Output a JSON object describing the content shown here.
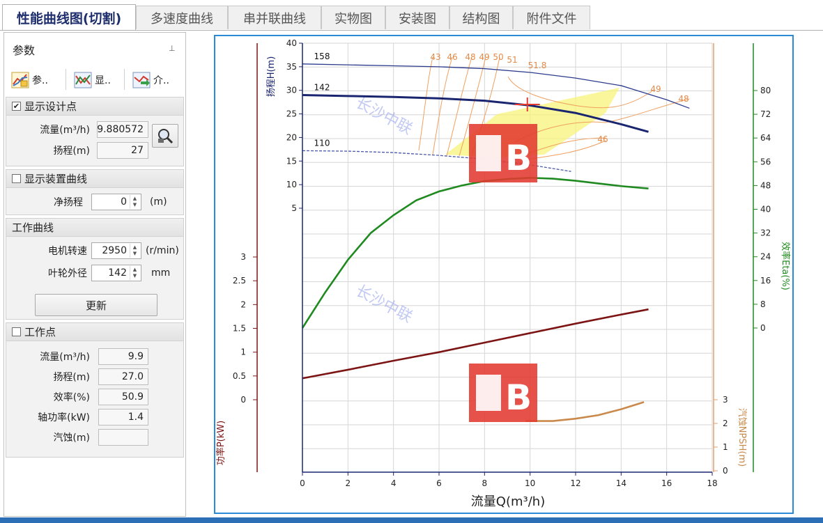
{
  "tabs": [
    {
      "label": "性能曲线图(切割)",
      "active": true
    },
    {
      "label": "多速度曲线"
    },
    {
      "label": "串并联曲线"
    },
    {
      "label": "实物图"
    },
    {
      "label": "安装图"
    },
    {
      "label": "结构图"
    },
    {
      "label": "附件文件"
    }
  ],
  "panel": {
    "title": "参数",
    "pin_icon": "pin-icon",
    "tools": [
      {
        "label": "参..",
        "icon": "parameter-curve-icon"
      },
      {
        "label": "显..",
        "icon": "display-curve-icon"
      },
      {
        "label": "介..",
        "icon": "medium-curve-icon"
      }
    ],
    "design_point": {
      "header": "显示设计点",
      "checked": true,
      "flow_label": "流量(m³/h)",
      "flow_value": "9.880572",
      "head_label": "扬程(m)",
      "head_value": "27",
      "search_icon": "magnifier-icon"
    },
    "device_curve": {
      "header": "显示装置曲线",
      "checked": false,
      "static_head_label": "净扬程",
      "static_head_value": "0",
      "static_head_unit": "(m)"
    },
    "work_curve": {
      "header": "工作曲线",
      "speed_label": "电机转速",
      "speed_value": "2950",
      "speed_unit": "(r/min)",
      "impeller_label": "叶轮外径",
      "impeller_value": "142",
      "impeller_unit": "mm",
      "update_button": "更新"
    },
    "work_point": {
      "header": "工作点",
      "checked": false,
      "rows": [
        {
          "label": "流量(m³/h)",
          "value": "9.9"
        },
        {
          "label": "扬程(m)",
          "value": "27.0"
        },
        {
          "label": "效率(%)",
          "value": "50.9"
        },
        {
          "label": "轴功率(kW)",
          "value": "1.4"
        },
        {
          "label": "汽蚀(m)",
          "value": ""
        }
      ]
    }
  },
  "chart_data": {
    "type": "line",
    "xlabel": "流量Q(m³/h)",
    "xlim": [
      0,
      18
    ],
    "x_ticks": [
      "0",
      "2",
      "4",
      "6",
      "8",
      "10",
      "12",
      "14",
      "16",
      "18"
    ],
    "head_axis": {
      "label": "扬程H(m)",
      "range": [
        0,
        40
      ],
      "ticks": [
        "5",
        "10",
        "15",
        "20",
        "25",
        "30",
        "35",
        "40"
      ]
    },
    "power_axis": {
      "label": "功率P(kW)",
      "range": [
        0,
        3
      ],
      "ticks": [
        "0",
        "0.5",
        "1",
        "1.5",
        "2",
        "2.5",
        "3"
      ]
    },
    "eta_axis": {
      "label": "效率Eta(%)",
      "range": [
        0,
        80
      ],
      "ticks": [
        "0",
        "8",
        "16",
        "24",
        "32",
        "40",
        "48",
        "56",
        "64",
        "72",
        "80"
      ]
    },
    "npsh_axis": {
      "label": "汽蚀NPSH(m)",
      "range": [
        0,
        3
      ],
      "ticks": [
        "0",
        "1",
        "2",
        "3"
      ]
    },
    "watermark": "长沙中联",
    "design_point": {
      "x": 9.88,
      "y": 27
    },
    "head_curves": [
      {
        "label": "158",
        "color": "#2b3a8c",
        "x": [
          0,
          2,
          4,
          6,
          8,
          10,
          12,
          14,
          16,
          17
        ],
        "y": [
          35.6,
          35.4,
          35.2,
          35.0,
          34.6,
          33.8,
          32.6,
          31.0,
          28.0,
          26.2
        ]
      },
      {
        "label": "142",
        "color": "#1a2570",
        "x": [
          0,
          2,
          4,
          6,
          8,
          10,
          12,
          14,
          15.2
        ],
        "y": [
          29.0,
          28.8,
          28.6,
          28.3,
          27.8,
          26.8,
          25.2,
          22.8,
          21.2
        ]
      },
      {
        "label": "110",
        "color": "#4a58a8",
        "x": [
          0,
          2,
          4,
          6,
          8,
          10,
          11.8
        ],
        "y": [
          17.2,
          17.1,
          16.8,
          16.2,
          15.4,
          14.2,
          12.8
        ]
      }
    ],
    "iso_efficiency_labels": [
      "43",
      "46",
      "48",
      "49",
      "50",
      "51",
      "51.8",
      "49",
      "48",
      "46"
    ],
    "efficiency_curve": {
      "color": "#1f8a1f",
      "x": [
        0,
        1,
        2,
        3,
        4,
        5,
        6,
        7,
        8,
        9,
        10,
        11,
        12,
        13,
        14,
        15.2
      ],
      "y": [
        0,
        12,
        23,
        32,
        38,
        43,
        46,
        48,
        49.5,
        50.2,
        50.6,
        50.3,
        49.6,
        48.7,
        47.8,
        47.0
      ]
    },
    "power_curve": {
      "color": "#7d1414",
      "x": [
        0,
        2,
        4,
        6,
        8,
        10,
        12,
        14,
        15.2
      ],
      "y": [
        0.45,
        0.63,
        0.82,
        1.0,
        1.2,
        1.4,
        1.6,
        1.79,
        1.9
      ]
    },
    "npsh_curve": {
      "color": "#c9894a",
      "x": [
        9.8,
        11,
        12,
        13,
        14,
        15
      ],
      "y": [
        2.1,
        2.1,
        2.2,
        2.35,
        2.6,
        2.9
      ]
    }
  },
  "logo_text": "ZLB"
}
